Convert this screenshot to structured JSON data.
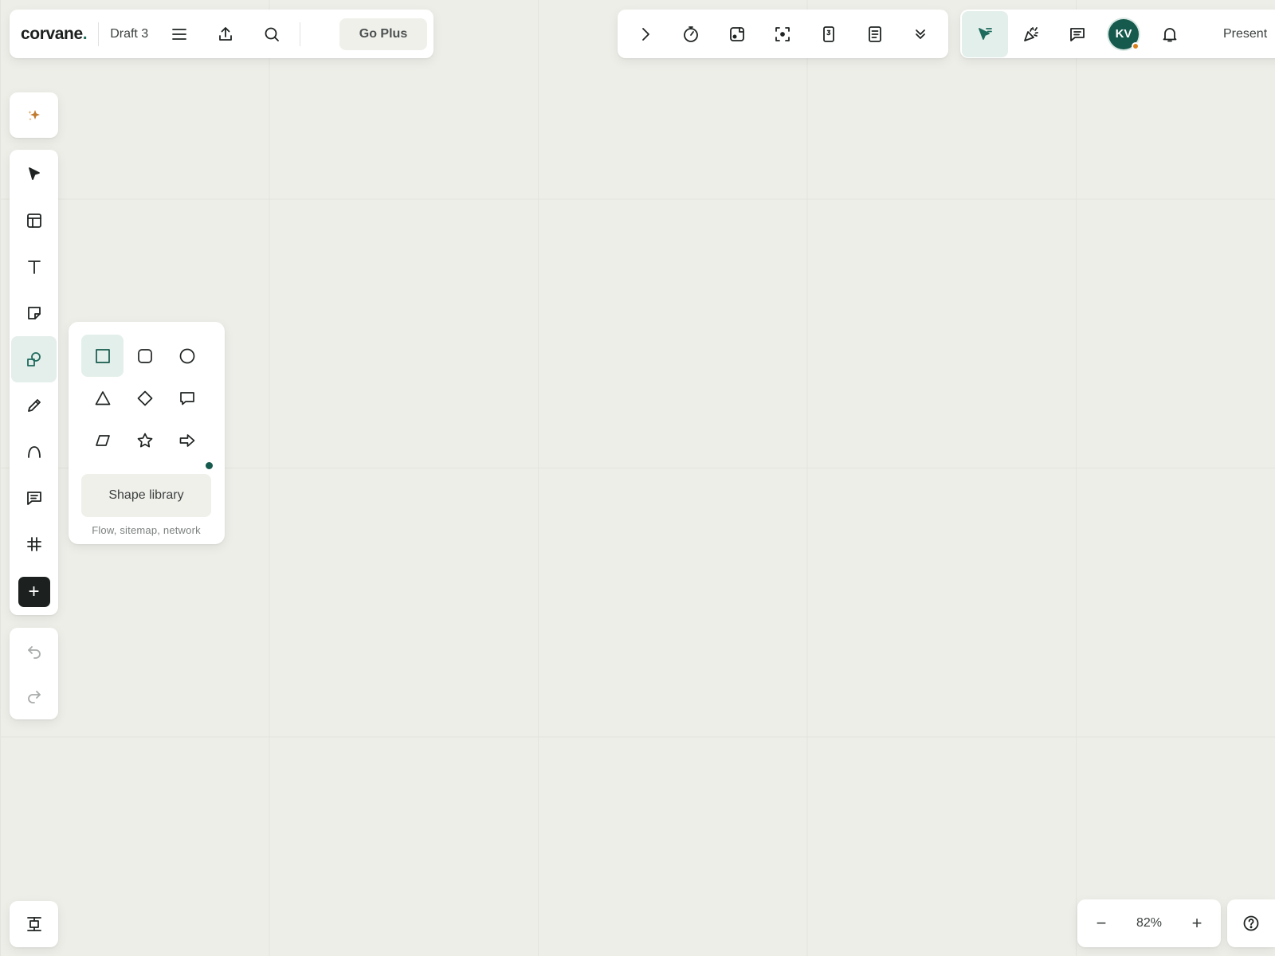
{
  "app": {
    "logo_text": "corvane",
    "logo_dot": ".",
    "brand_color": "#1d6b5c"
  },
  "header": {
    "board_title": "Draft 3",
    "menu_icon": "hamburger-menu-icon",
    "export_icon": "upload-icon",
    "search_icon": "search-icon",
    "upgrade_label": "Go Plus"
  },
  "top_tools": [
    "chevron-right-icon",
    "timer-icon",
    "embed-icon",
    "focus-icon",
    "page-number-icon",
    "notes-icon",
    "double-chevron-down-icon"
  ],
  "collab": {
    "cursor_icon": "cursor-chat-icon",
    "reactions_icon": "party-popper-icon",
    "comments_icon": "comment-icon",
    "avatar_initials": "KV",
    "avatar_color": "#16594d",
    "status_color": "#d9801c",
    "notifications_icon": "bell-icon",
    "present_label": "Present"
  },
  "left_toolbar": {
    "ai_icon": "sparkles-icon",
    "tools": [
      "select-icon",
      "template-icon",
      "text-icon",
      "sticky-note-icon",
      "shapes-icon",
      "pen-icon",
      "connector-icon",
      "comment-icon",
      "grid-icon"
    ],
    "selected_tool": "shapes",
    "add_label": "+",
    "undo_icon": "undo-icon",
    "redo_icon": "redo-icon",
    "frames_icon": "frames-icon"
  },
  "shape_popover": {
    "shapes": [
      "rectangle",
      "rounded-rectangle",
      "circle",
      "triangle",
      "diamond",
      "speech-bubble",
      "parallelogram",
      "star",
      "arrow-right"
    ],
    "selected_shape": "rectangle",
    "library_button": "Shape library",
    "library_subtitle": "Flow, sitemap, network"
  },
  "zoom": {
    "value": "82%",
    "minus": "−",
    "plus": "+"
  },
  "help_icon": "help-circle-icon"
}
